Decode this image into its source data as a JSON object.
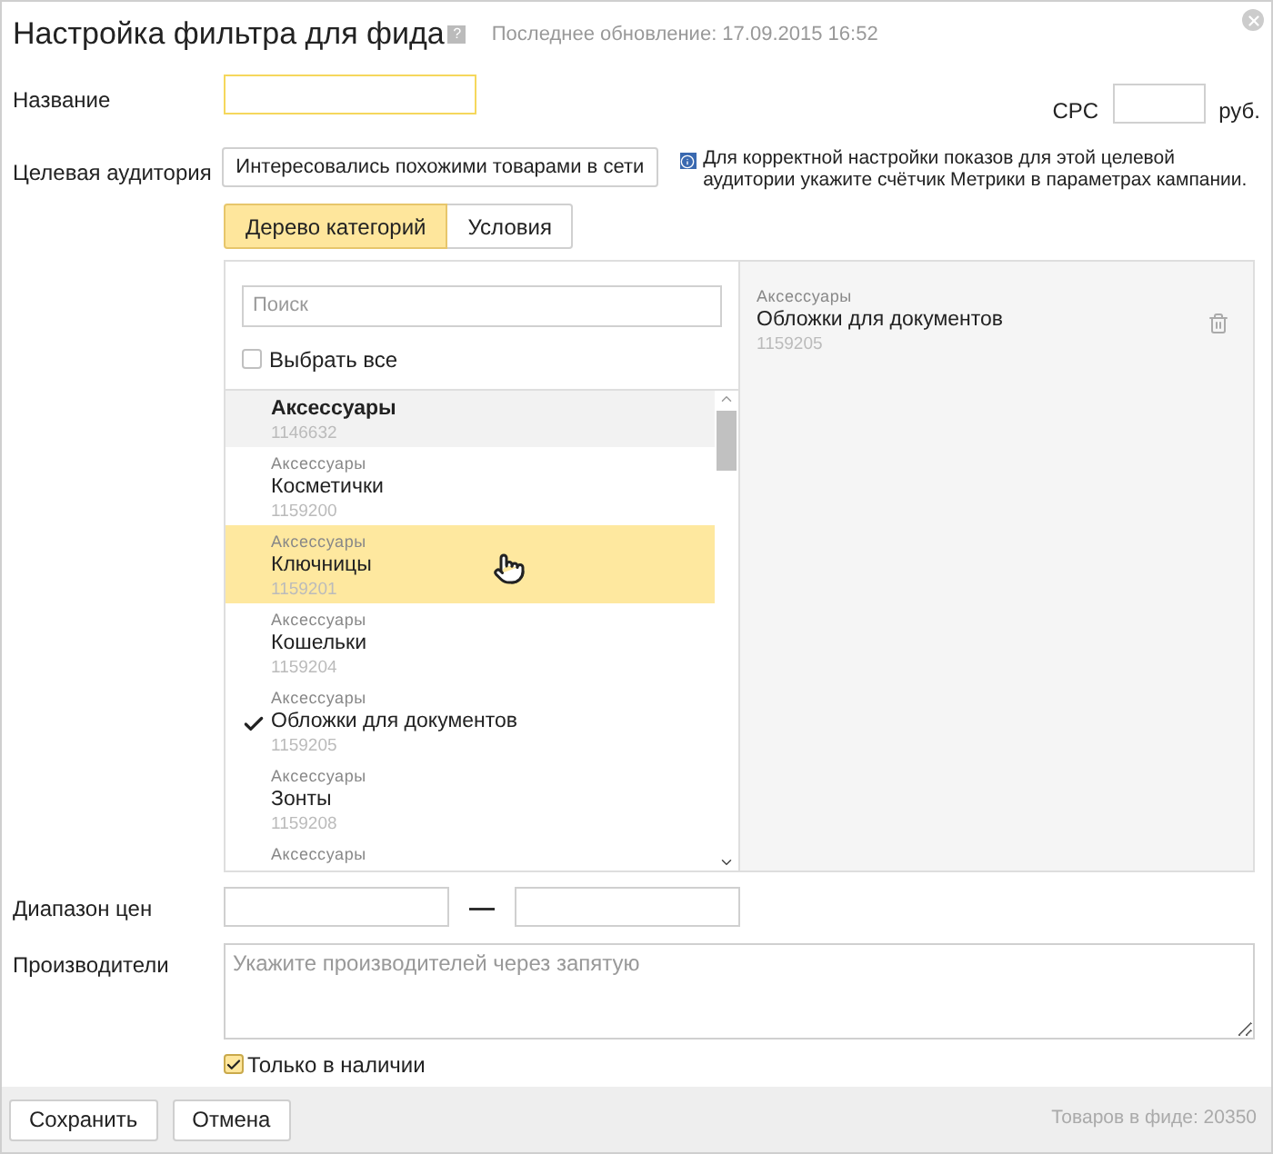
{
  "dialog": {
    "title": "Настройка фильтра для фида",
    "help": "?",
    "updated": "Последнее обновление: 17.09.2015 16:52"
  },
  "name_field": {
    "label": "Название"
  },
  "cpc": {
    "label": "CPC",
    "unit": "руб."
  },
  "audience": {
    "label": "Целевая аудитория",
    "value": "Интересовались похожими товарами в сети",
    "notice": "Для корректной настройки показов для этой целевой аудитории укажите счётчик Метрики в параметрах кампании."
  },
  "tabs": [
    {
      "label": "Дерево категорий",
      "selected": true
    },
    {
      "label": "Условия",
      "selected": false
    }
  ],
  "search": {
    "placeholder": "Поиск"
  },
  "select_all": {
    "label": "Выбрать все",
    "checked": false
  },
  "categories": [
    {
      "kind": "group",
      "name": "Аксессуары",
      "id": "1146632",
      "checked": false,
      "hovered": false
    },
    {
      "kind": "item",
      "parent": "Аксессуары",
      "name": "Косметички",
      "id": "1159200",
      "checked": false,
      "hovered": false
    },
    {
      "kind": "item",
      "parent": "Аксессуары",
      "name": "Ключницы",
      "id": "1159201",
      "checked": false,
      "hovered": true
    },
    {
      "kind": "item",
      "parent": "Аксессуары",
      "name": "Кошельки",
      "id": "1159204",
      "checked": false,
      "hovered": false
    },
    {
      "kind": "item",
      "parent": "Аксессуары",
      "name": "Обложки для документов",
      "id": "1159205",
      "checked": true,
      "hovered": false
    },
    {
      "kind": "item",
      "parent": "Аксессуары",
      "name": "Зонты",
      "id": "1159208",
      "checked": false,
      "hovered": false
    },
    {
      "kind": "item",
      "parent": "Аксессуары",
      "checked": false,
      "hovered": false
    }
  ],
  "chosen": [
    {
      "parent": "Аксессуары",
      "name": "Обложки для документов",
      "id": "1159205"
    }
  ],
  "price_range": {
    "label": "Диапазон цен",
    "separator": "—"
  },
  "vendors": {
    "label": "Производители",
    "placeholder": "Укажите производителей через запятую"
  },
  "in_stock": {
    "label": "Только в наличии",
    "checked": true
  },
  "buttons": [
    "Сохранить",
    "Отмена"
  ],
  "footer_note": "Товаров в фиде: 20350"
}
